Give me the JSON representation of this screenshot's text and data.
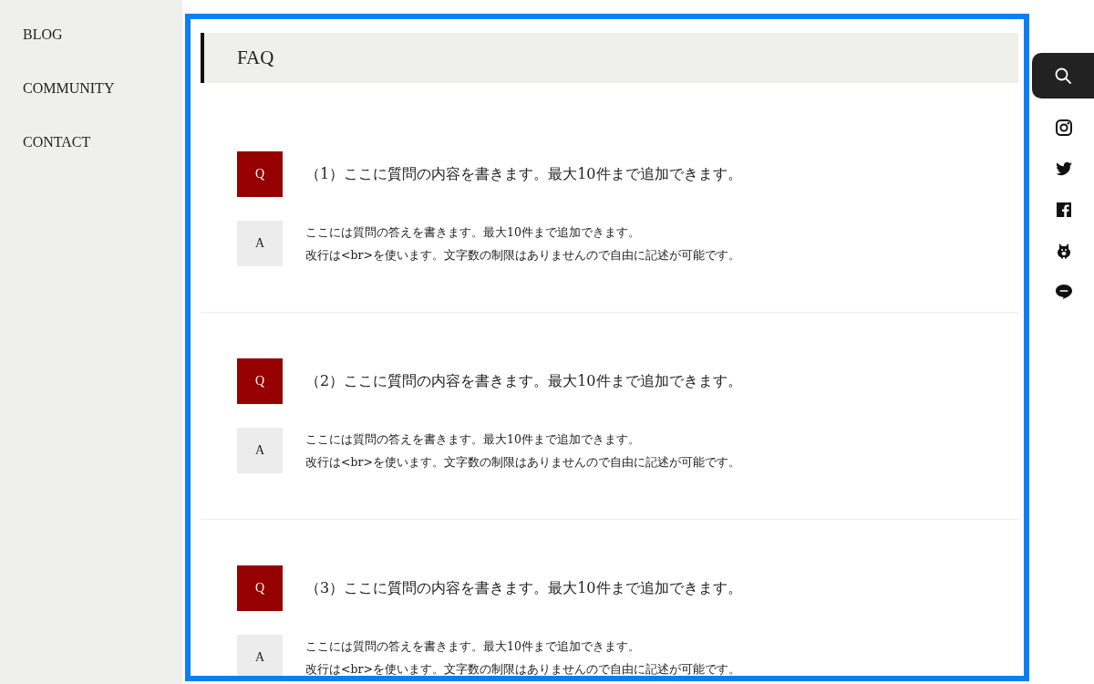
{
  "sidebar": {
    "items": [
      {
        "label": "BLOG"
      },
      {
        "label": "COMMUNITY"
      },
      {
        "label": "CONTACT"
      }
    ]
  },
  "section": {
    "title": "FAQ"
  },
  "faq": [
    {
      "q_mark": "Q",
      "question": "（1）ここに質問の内容を書きます。最大10件まで追加できます。",
      "a_mark": "A",
      "answer": [
        "ここには質問の答えを書きます。最大10件まで追加できます。",
        "改行は<br>を使います。文字数の制限はありませんので自由に記述が可能です。"
      ]
    },
    {
      "q_mark": "Q",
      "question": "（2）ここに質問の内容を書きます。最大10件まで追加できます。",
      "a_mark": "A",
      "answer": [
        "ここには質問の答えを書きます。最大10件まで追加できます。",
        "改行は<br>を使います。文字数の制限はありませんので自由に記述が可能です。"
      ]
    },
    {
      "q_mark": "Q",
      "question": "（3）ここに質問の内容を書きます。最大10件まで追加できます。",
      "a_mark": "A",
      "answer": [
        "ここには質問の答えを書きます。最大10件まで追加できます。",
        "改行は<br>を使います。文字数の制限はありませんので自由に記述が可能です。"
      ]
    }
  ]
}
